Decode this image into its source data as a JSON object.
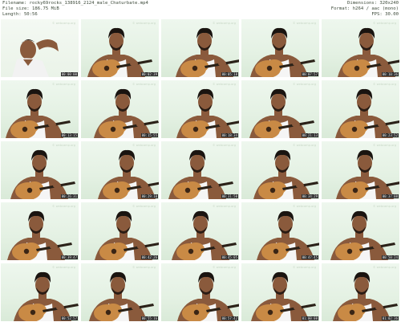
{
  "header": {
    "filename": "Filename: rocky69rocks_138916_2124_male_Chaturbate.mp4",
    "filesize": "File size: 186.75 MiB",
    "length": "Length: 50:56",
    "dimensions": "Dimensions: 320x240",
    "format": "Format: h264 / aac (mono)",
    "fps": "FPS: 30.00"
  },
  "watermark": "© webcamp.org",
  "thumbnails": [
    {
      "time": "00:00:00"
    },
    {
      "time": "00:02:39"
    },
    {
      "time": "00:05:18"
    },
    {
      "time": "00:07:57"
    },
    {
      "time": "00:10:36"
    },
    {
      "time": "00:13:15"
    },
    {
      "time": "00:15:55"
    },
    {
      "time": "00:18:34"
    },
    {
      "time": "00:21:13"
    },
    {
      "time": "00:23:52"
    },
    {
      "time": "00:26:31"
    },
    {
      "time": "00:29:10"
    },
    {
      "time": "00:31:50"
    },
    {
      "time": "00:34:29"
    },
    {
      "time": "00:37:08"
    },
    {
      "time": "00:39:47"
    },
    {
      "time": "00:42:26"
    },
    {
      "time": "00:45:05"
    },
    {
      "time": "00:47:45"
    },
    {
      "time": "00:50:24"
    },
    {
      "time": "00:52:57"
    },
    {
      "time": "00:55:16"
    },
    {
      "time": "00:57:42"
    },
    {
      "time": "01:00:08"
    },
    {
      "time": "01:02:36"
    }
  ]
}
